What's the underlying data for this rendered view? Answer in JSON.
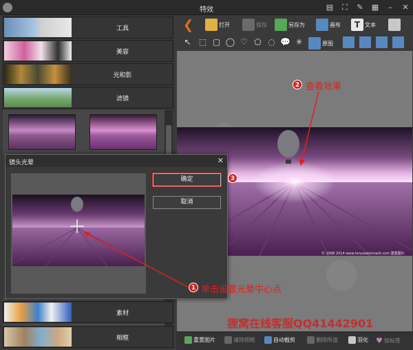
{
  "window": {
    "title": "特效"
  },
  "categories": [
    {
      "label": "工具"
    },
    {
      "label": "美容"
    },
    {
      "label": "光和影"
    },
    {
      "label": "滤镜"
    },
    {
      "label": "素材"
    },
    {
      "label": "相框"
    }
  ],
  "toolbar": {
    "open": "打开",
    "save": "保存",
    "save_as": "另存为",
    "canvas": "画布",
    "text": "文本",
    "original": "原图"
  },
  "dialog": {
    "title": "镜头光晕",
    "ok": "确定",
    "cancel": "取消"
  },
  "bottom": {
    "reset": "重置图片",
    "clear_frame": "清除相框",
    "auto_crop": "自动截剪",
    "delete_selected": "删除所选",
    "feather": "羽化",
    "add_to_favorites": "加标签"
  },
  "annotations": {
    "step1_num": "1",
    "step1_text": "单击设置光晕中心点",
    "step2_num": "2",
    "step2_text": "查看效果",
    "step3_num": "3"
  },
  "watermark": "狸窝在线客服QQ41442901",
  "image_caption": "© 1998 2014 www.tonywatermark.com 重置图片",
  "colors": {
    "accent_red": "#d32020",
    "lavender": "#8e5a8c",
    "sky": "#2a1830"
  }
}
